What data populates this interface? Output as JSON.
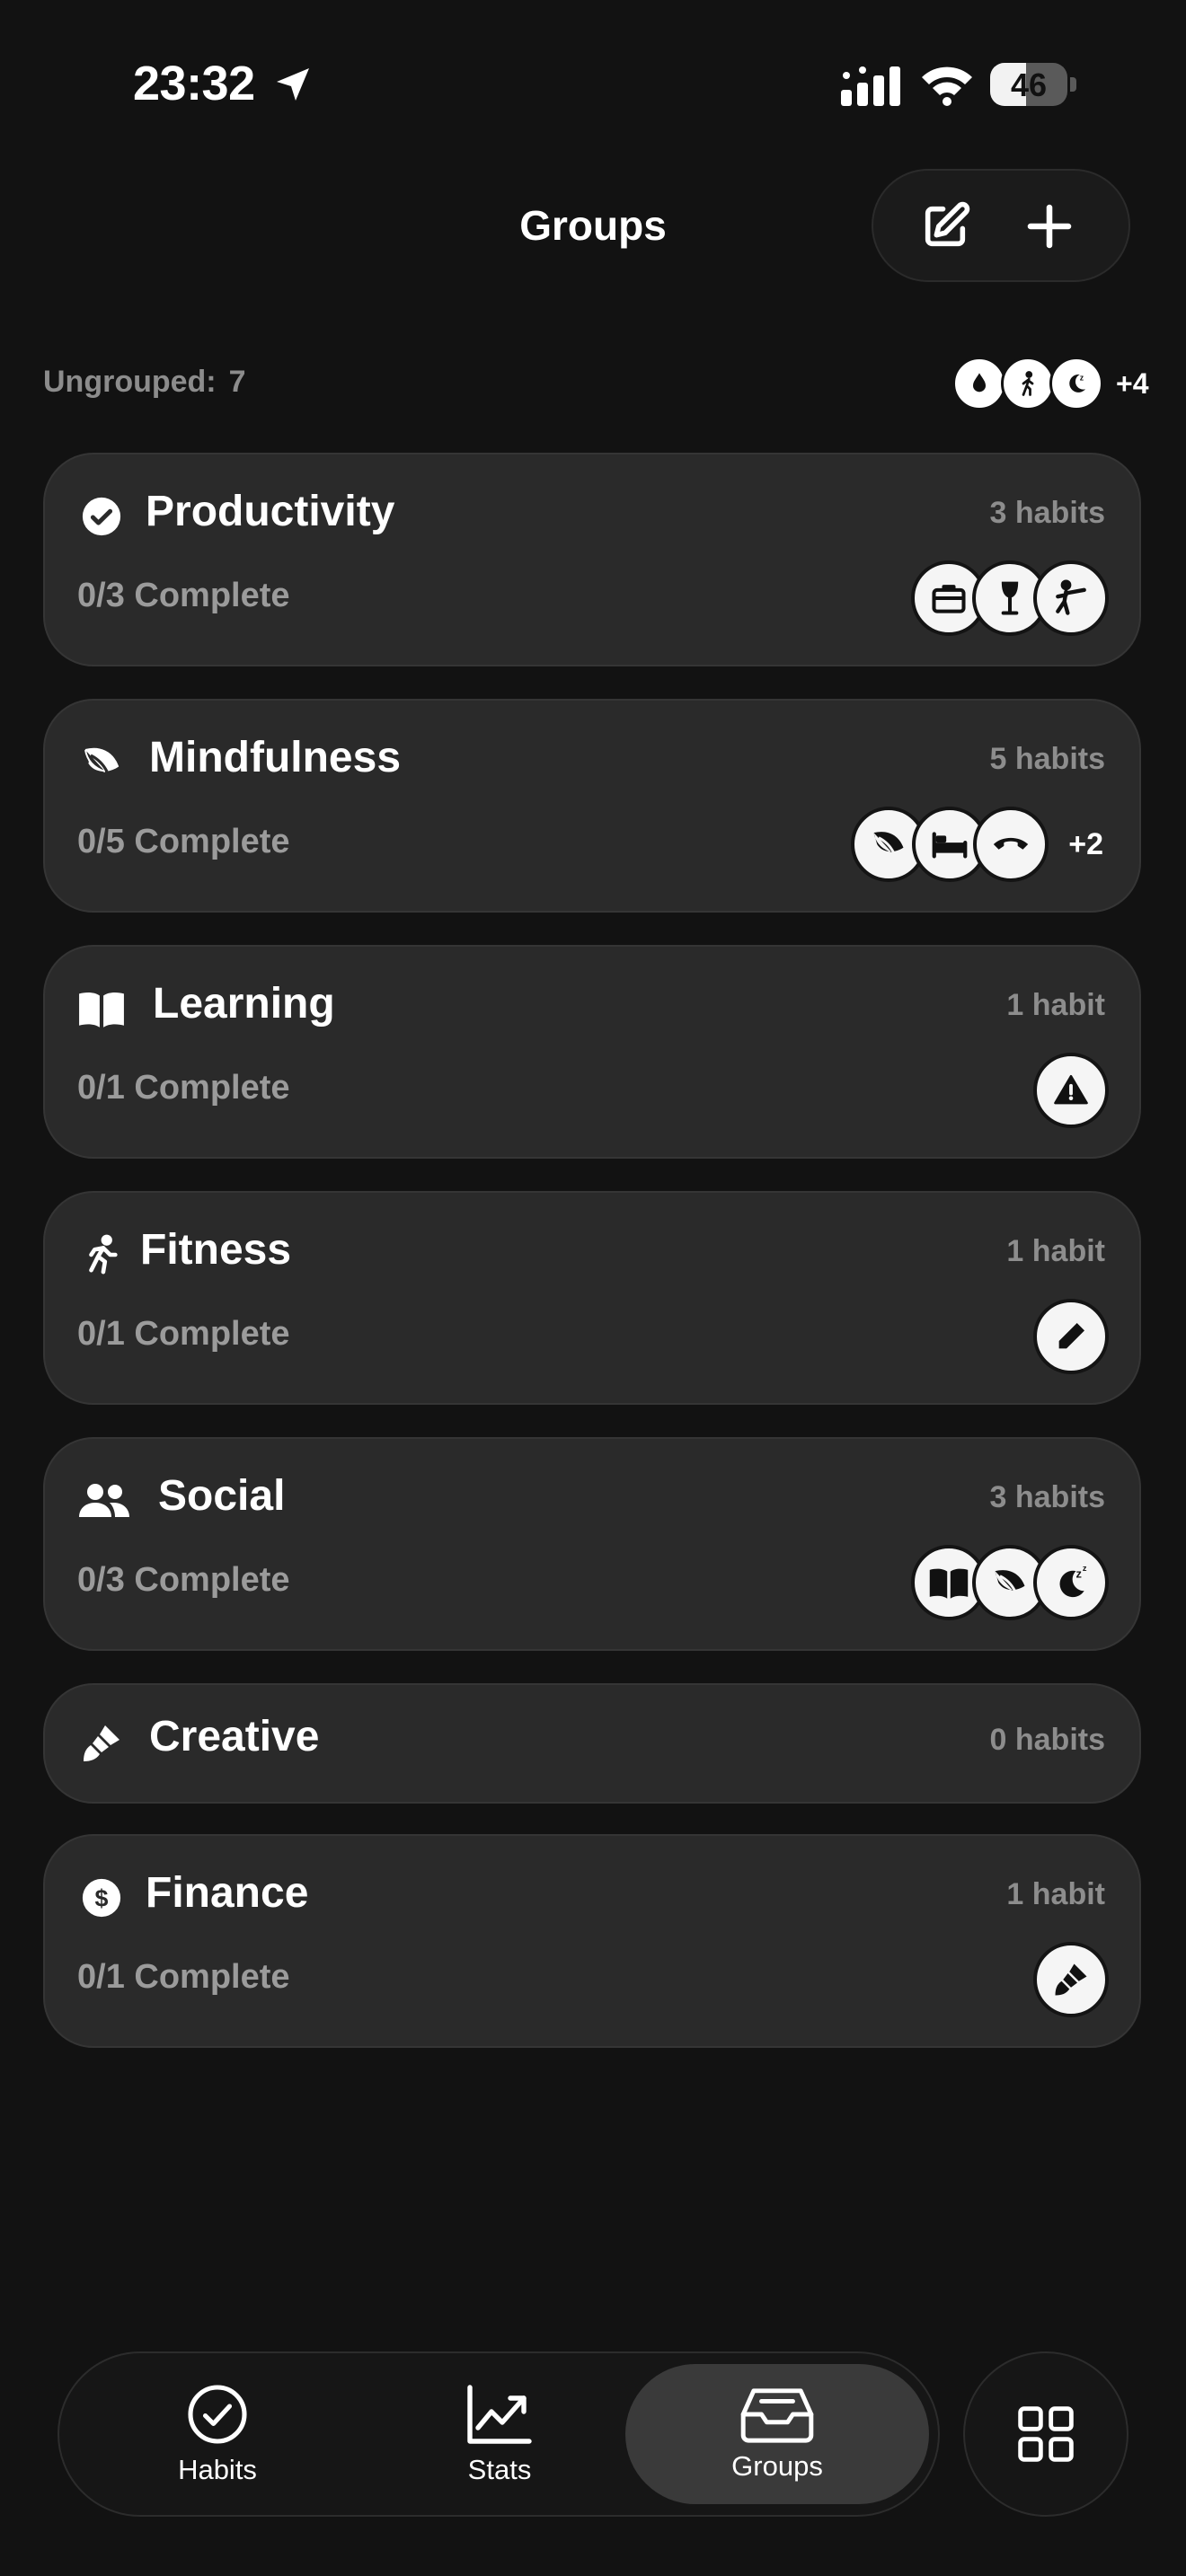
{
  "status_bar": {
    "time": "23:32",
    "battery": "46",
    "battery_level": 0.46
  },
  "header": {
    "title": "Groups",
    "icons": [
      "compose-icon",
      "plus-icon"
    ]
  },
  "ungrouped": {
    "label": "Ungrouped:",
    "count": "7",
    "icons": [
      "drop-icon",
      "walking-icon",
      "sleep-icon"
    ],
    "more": "+4"
  },
  "groups": [
    {
      "name": "Productivity",
      "icon": "check-circle-icon",
      "habit_count": "3 habits",
      "complete": "0/3 Complete",
      "habit_icons": [
        "briefcase-icon",
        "wine-glass-icon",
        "kick-icon"
      ],
      "more": ""
    },
    {
      "name": "Mindfulness",
      "icon": "leaf-icon",
      "habit_count": "5 habits",
      "complete": "0/5 Complete",
      "habit_icons": [
        "leaf-icon",
        "bed-icon",
        "phone-icon"
      ],
      "more": "+2"
    },
    {
      "name": "Learning",
      "icon": "book-icon",
      "habit_count": "1 habit",
      "complete": "0/1 Complete",
      "habit_icons": [
        "warning-icon"
      ],
      "more": ""
    },
    {
      "name": "Fitness",
      "icon": "running-icon",
      "habit_count": "1 habit",
      "complete": "0/1 Complete",
      "habit_icons": [
        "pencil-icon"
      ],
      "more": ""
    },
    {
      "name": "Social",
      "icon": "people-icon",
      "habit_count": "3 habits",
      "complete": "0/3 Complete",
      "habit_icons": [
        "book-icon",
        "leaf-icon",
        "sleep-icon"
      ],
      "more": ""
    },
    {
      "name": "Creative",
      "icon": "brush-icon",
      "habit_count": "0 habits",
      "complete": "",
      "habit_icons": [],
      "more": ""
    },
    {
      "name": "Finance",
      "icon": "dollar-icon",
      "habit_count": "1 habit",
      "complete": "0/1 Complete",
      "habit_icons": [
        "brush-icon"
      ],
      "more": ""
    }
  ],
  "tabbar": {
    "tabs": [
      {
        "label": "Habits",
        "icon": "check-circle-outline-icon"
      },
      {
        "label": "Stats",
        "icon": "chart-up-icon"
      },
      {
        "label": "Groups",
        "icon": "inbox-icon",
        "selected": true
      }
    ],
    "menu_icon": "grid-icon"
  }
}
